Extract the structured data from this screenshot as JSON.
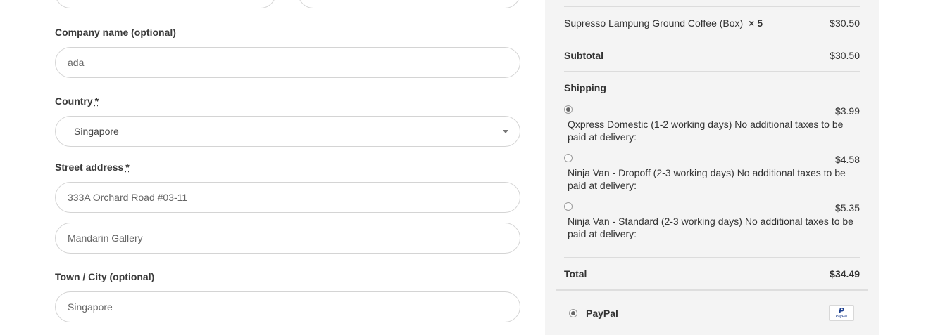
{
  "form": {
    "company": {
      "label": "Company name (optional)",
      "value": "ada"
    },
    "country": {
      "label": "Country",
      "required_mark": "*",
      "value": "Singapore"
    },
    "street": {
      "label": "Street address",
      "required_mark": "*",
      "line1": "333A Orchard Road #03-11",
      "line2": "Mandarin Gallery"
    },
    "city": {
      "label": "Town / City (optional)",
      "value": "Singapore"
    }
  },
  "order": {
    "item": {
      "name": "Supresso Lampung Ground Coffee (Box)",
      "qty": "× 5",
      "amount": "$30.50"
    },
    "subtotal": {
      "label": "Subtotal",
      "amount": "$30.50"
    },
    "shipping": {
      "label": "Shipping",
      "options": [
        {
          "price": "$3.99",
          "desc": "Qxpress Domestic (1-2 working days) No additional taxes to be paid at delivery:",
          "selected": true
        },
        {
          "price": "$4.58",
          "desc": "Ninja Van - Dropoff (2-3 working days) No additional taxes to be paid at delivery:",
          "selected": false
        },
        {
          "price": "$5.35",
          "desc": "Ninja Van - Standard (2-3 working days) No additional taxes to be paid at delivery:",
          "selected": false
        }
      ]
    },
    "total": {
      "label": "Total",
      "amount": "$34.49"
    }
  },
  "payment": {
    "method": "PayPal",
    "logo_text": "PayPal",
    "logo_letter": "P",
    "selected": true
  }
}
